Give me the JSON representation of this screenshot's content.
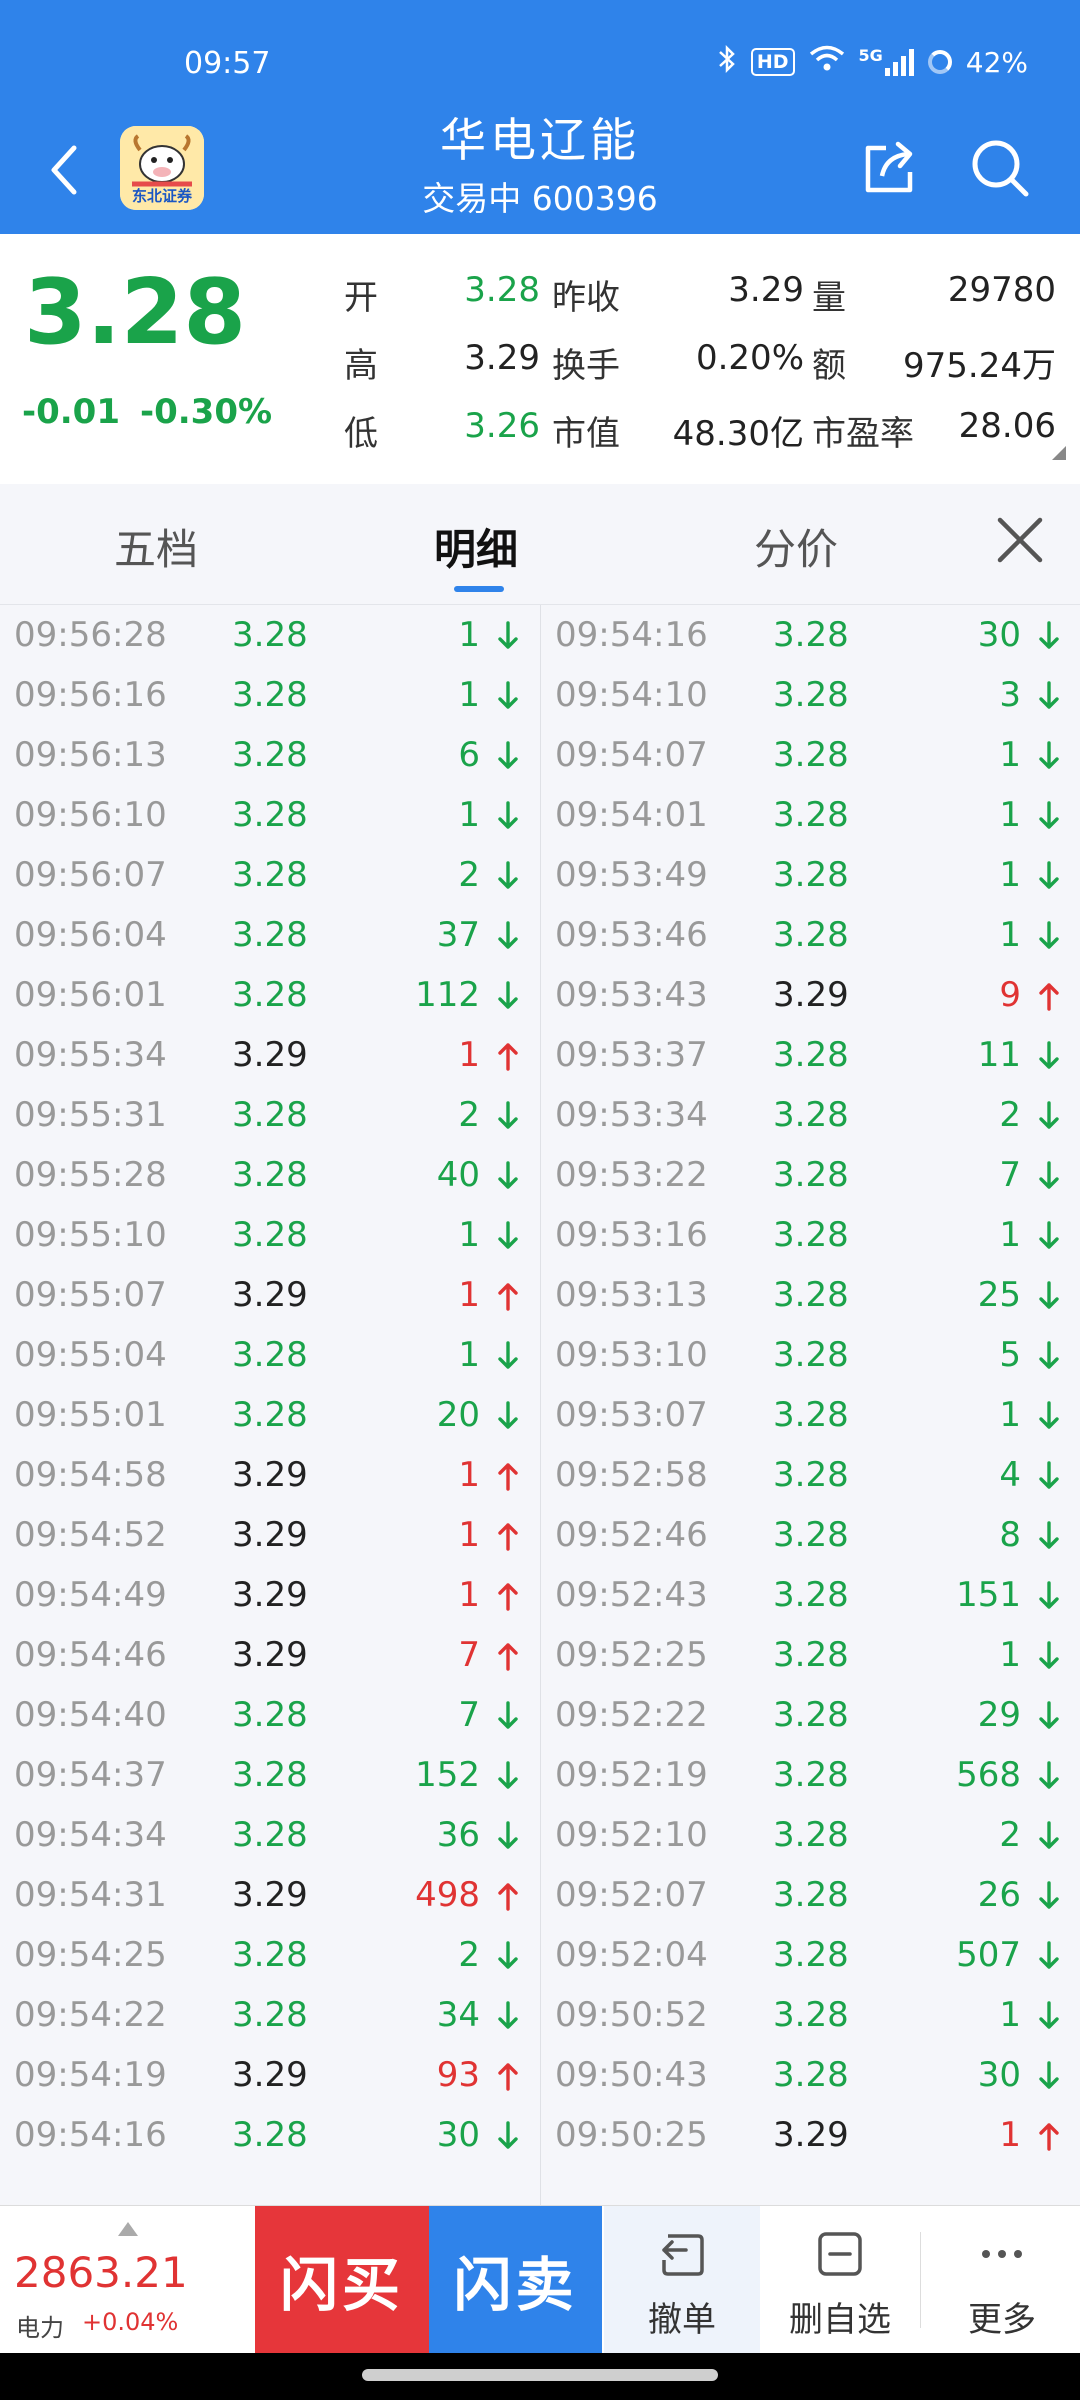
{
  "status": {
    "time": "09:57",
    "hd": "HD",
    "net": "5G",
    "battery": "42%"
  },
  "header": {
    "logo_text": "东北证券",
    "stock_name": "华电辽能",
    "status_text": "交易中 600396"
  },
  "quote": {
    "last": "3.28",
    "change": "-0.01",
    "change_pct": "-0.30%",
    "rows": [
      {
        "l1": "开",
        "v1": "3.28",
        "l2": "昨收",
        "v2": "3.29",
        "l3": "量",
        "v3": "29780"
      },
      {
        "l1": "高",
        "v1": "3.29",
        "l2": "换手",
        "v2": "0.20%",
        "l3": "额",
        "v3": "975.24万"
      },
      {
        "l1": "低",
        "v1": "3.26",
        "l2": "市值",
        "v2": "48.30亿",
        "l3": "市盈率",
        "v3": "28.06"
      }
    ]
  },
  "tabs": [
    "五档",
    "明细",
    "分价"
  ],
  "ticks_left": [
    {
      "time": "09:56:28",
      "price": "3.28",
      "vol": "1",
      "dir": "down"
    },
    {
      "time": "09:56:16",
      "price": "3.28",
      "vol": "1",
      "dir": "down"
    },
    {
      "time": "09:56:13",
      "price": "3.28",
      "vol": "6",
      "dir": "down"
    },
    {
      "time": "09:56:10",
      "price": "3.28",
      "vol": "1",
      "dir": "down"
    },
    {
      "time": "09:56:07",
      "price": "3.28",
      "vol": "2",
      "dir": "down"
    },
    {
      "time": "09:56:04",
      "price": "3.28",
      "vol": "37",
      "dir": "down"
    },
    {
      "time": "09:56:01",
      "price": "3.28",
      "vol": "112",
      "dir": "down"
    },
    {
      "time": "09:55:34",
      "price": "3.29",
      "vol": "1",
      "dir": "up"
    },
    {
      "time": "09:55:31",
      "price": "3.28",
      "vol": "2",
      "dir": "down"
    },
    {
      "time": "09:55:28",
      "price": "3.28",
      "vol": "40",
      "dir": "down"
    },
    {
      "time": "09:55:10",
      "price": "3.28",
      "vol": "1",
      "dir": "down"
    },
    {
      "time": "09:55:07",
      "price": "3.29",
      "vol": "1",
      "dir": "up"
    },
    {
      "time": "09:55:04",
      "price": "3.28",
      "vol": "1",
      "dir": "down"
    },
    {
      "time": "09:55:01",
      "price": "3.28",
      "vol": "20",
      "dir": "down"
    },
    {
      "time": "09:54:58",
      "price": "3.29",
      "vol": "1",
      "dir": "up"
    },
    {
      "time": "09:54:52",
      "price": "3.29",
      "vol": "1",
      "dir": "up"
    },
    {
      "time": "09:54:49",
      "price": "3.29",
      "vol": "1",
      "dir": "up"
    },
    {
      "time": "09:54:46",
      "price": "3.29",
      "vol": "7",
      "dir": "up"
    },
    {
      "time": "09:54:40",
      "price": "3.28",
      "vol": "7",
      "dir": "down"
    },
    {
      "time": "09:54:37",
      "price": "3.28",
      "vol": "152",
      "dir": "down"
    },
    {
      "time": "09:54:34",
      "price": "3.28",
      "vol": "36",
      "dir": "down"
    },
    {
      "time": "09:54:31",
      "price": "3.29",
      "vol": "498",
      "dir": "up"
    },
    {
      "time": "09:54:25",
      "price": "3.28",
      "vol": "2",
      "dir": "down"
    },
    {
      "time": "09:54:22",
      "price": "3.28",
      "vol": "34",
      "dir": "down"
    },
    {
      "time": "09:54:19",
      "price": "3.29",
      "vol": "93",
      "dir": "up"
    },
    {
      "time": "09:54:16",
      "price": "3.28",
      "vol": "30",
      "dir": "down"
    }
  ],
  "ticks_right": [
    {
      "time": "09:54:16",
      "price": "3.28",
      "vol": "30",
      "dir": "down"
    },
    {
      "time": "09:54:10",
      "price": "3.28",
      "vol": "3",
      "dir": "down"
    },
    {
      "time": "09:54:07",
      "price": "3.28",
      "vol": "1",
      "dir": "down"
    },
    {
      "time": "09:54:01",
      "price": "3.28",
      "vol": "1",
      "dir": "down"
    },
    {
      "time": "09:53:49",
      "price": "3.28",
      "vol": "1",
      "dir": "down"
    },
    {
      "time": "09:53:46",
      "price": "3.28",
      "vol": "1",
      "dir": "down"
    },
    {
      "time": "09:53:43",
      "price": "3.29",
      "vol": "9",
      "dir": "up"
    },
    {
      "time": "09:53:37",
      "price": "3.28",
      "vol": "11",
      "dir": "down"
    },
    {
      "time": "09:53:34",
      "price": "3.28",
      "vol": "2",
      "dir": "down"
    },
    {
      "time": "09:53:22",
      "price": "3.28",
      "vol": "7",
      "dir": "down"
    },
    {
      "time": "09:53:16",
      "price": "3.28",
      "vol": "1",
      "dir": "down"
    },
    {
      "time": "09:53:13",
      "price": "3.28",
      "vol": "25",
      "dir": "down"
    },
    {
      "time": "09:53:10",
      "price": "3.28",
      "vol": "5",
      "dir": "down"
    },
    {
      "time": "09:53:07",
      "price": "3.28",
      "vol": "1",
      "dir": "down"
    },
    {
      "time": "09:52:58",
      "price": "3.28",
      "vol": "4",
      "dir": "down"
    },
    {
      "time": "09:52:46",
      "price": "3.28",
      "vol": "8",
      "dir": "down"
    },
    {
      "time": "09:52:43",
      "price": "3.28",
      "vol": "151",
      "dir": "down"
    },
    {
      "time": "09:52:25",
      "price": "3.28",
      "vol": "1",
      "dir": "down"
    },
    {
      "time": "09:52:22",
      "price": "3.28",
      "vol": "29",
      "dir": "down"
    },
    {
      "time": "09:52:19",
      "price": "3.28",
      "vol": "568",
      "dir": "down"
    },
    {
      "time": "09:52:10",
      "price": "3.28",
      "vol": "2",
      "dir": "down"
    },
    {
      "time": "09:52:07",
      "price": "3.28",
      "vol": "26",
      "dir": "down"
    },
    {
      "time": "09:52:04",
      "price": "3.28",
      "vol": "507",
      "dir": "down"
    },
    {
      "time": "09:50:52",
      "price": "3.28",
      "vol": "1",
      "dir": "down"
    },
    {
      "time": "09:50:43",
      "price": "3.28",
      "vol": "30",
      "dir": "down"
    },
    {
      "time": "09:50:25",
      "price": "3.29",
      "vol": "1",
      "dir": "up"
    }
  ],
  "bottom": {
    "index_value": "2863.21",
    "index_name": "电力",
    "index_change": "+0.04%",
    "buy_label": "闪买",
    "sell_label": "闪卖",
    "cancel_label": "撤单",
    "unfav_label": "删自选",
    "more_label": "更多"
  },
  "colors": {
    "header_blue": "#2f83ea",
    "up_red": "#e03333",
    "down_green": "#1aa34a",
    "buy_red": "#e6363a"
  }
}
